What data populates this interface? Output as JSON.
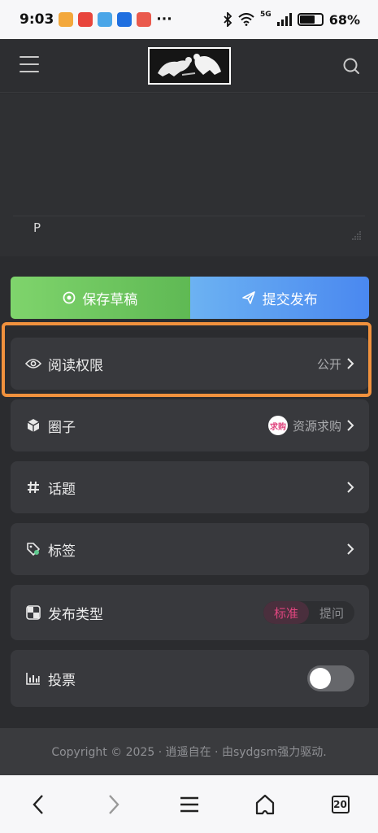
{
  "status_bar": {
    "time": "9:03",
    "extra": "···",
    "network": "5G",
    "battery": "68%",
    "battery_level": 0.68
  },
  "header": {
    "menu_icon": "hamburger-icon",
    "search_icon": "search-icon"
  },
  "editor": {
    "content": "P"
  },
  "actions": {
    "save_label": "保存草稿",
    "submit_label": "提交发布"
  },
  "settings": {
    "read_permission": {
      "label": "阅读权限",
      "value": "公开"
    },
    "circle": {
      "label": "圈子",
      "badge": "求购",
      "value": "资源求购"
    },
    "topic": {
      "label": "话题"
    },
    "tag": {
      "label": "标签"
    },
    "publish_type": {
      "label": "发布类型",
      "options": [
        "标准",
        "提问"
      ],
      "selected": "标准"
    },
    "vote": {
      "label": "投票",
      "enabled": false
    }
  },
  "footer": {
    "copyright": "Copyright © 2025 · 逍遥自在 · 由sydgsm强力驱动."
  },
  "bottom_nav": {
    "tab_count": "20"
  },
  "colors": {
    "highlight": "#f0913d",
    "accent_pink": "#e0467f",
    "save_green": "#6cc75f",
    "submit_blue": "#5a9df1"
  }
}
